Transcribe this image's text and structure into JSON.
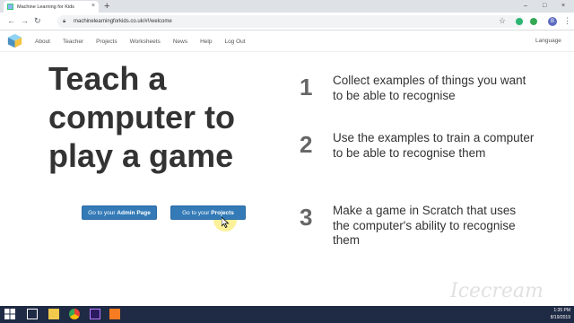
{
  "browser": {
    "tab_title": "Machine Learning for Kids",
    "tab_close": "×",
    "new_tab": "+",
    "url": "machinelearningforkids.co.uk/#!/welcome",
    "window_controls": [
      "–",
      "□",
      "×"
    ],
    "avatar_letter": "B"
  },
  "site": {
    "nav": [
      "About",
      "Teacher",
      "Projects",
      "Worksheets",
      "News",
      "Help",
      "Log Out"
    ],
    "language": "Language"
  },
  "hero": {
    "line1": "Teach a",
    "line2": "computer to",
    "line3": "play a game"
  },
  "buttons": {
    "admin_prefix": "Go to your ",
    "admin_strong": "Admin Page",
    "projects_prefix": "Go to your ",
    "projects_strong": "Projects"
  },
  "steps": [
    {
      "num": "1",
      "text": "Collect examples of things you want to be able to recognise"
    },
    {
      "num": "2",
      "text": "Use the examples to train a computer to be able to recognise them"
    },
    {
      "num": "3",
      "text": "Make a game in Scratch that uses the computer's ability to recognise them"
    }
  ],
  "watermark": "Icecream",
  "taskbar": {
    "time": "1:35 PM",
    "date": "8/19/2019"
  },
  "colors": {
    "button_bg": "#337ab7",
    "taskbar_bg": "#1f2a44",
    "hero_text": "#333333"
  }
}
